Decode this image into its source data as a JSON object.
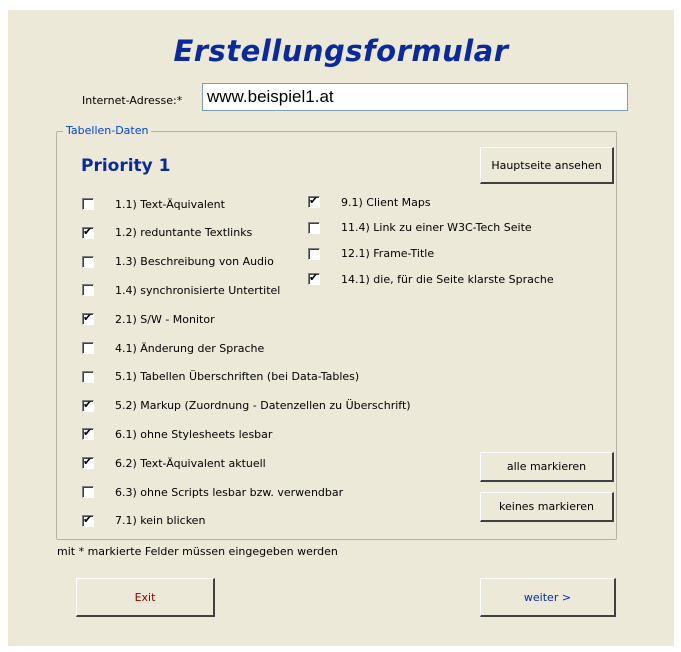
{
  "title": "Erstellungsformular",
  "url_field": {
    "label": "Internet-Adresse:*",
    "value": "www.beispiel1.at"
  },
  "group": {
    "legend": "Tabellen-Daten",
    "heading": "Priority 1"
  },
  "buttons": {
    "main_page": "Hauptseite ansehen",
    "select_all": "alle markieren",
    "select_none": "keines markieren",
    "exit": "Exit",
    "next": "weiter >"
  },
  "left_checks": [
    {
      "label": "1.1) Text-Äquivalent",
      "checked": false
    },
    {
      "label": "1.2) reduntante Textlinks",
      "checked": true
    },
    {
      "label": "1.3) Beschreibung von Audio",
      "checked": false
    },
    {
      "label": "1.4) synchronisierte Untertitel",
      "checked": false
    },
    {
      "label": "2.1) S/W - Monitor",
      "checked": true
    },
    {
      "label": "4.1) Änderung der Sprache",
      "checked": false
    },
    {
      "label": "5.1) Tabellen Überschriften (bei Data-Tables)",
      "checked": false
    },
    {
      "label": "5.2) Markup (Zuordnung - Datenzellen zu Überschrift)",
      "checked": true
    },
    {
      "label": "6.1) ohne Stylesheets lesbar",
      "checked": true
    },
    {
      "label": "6.2) Text-Äquivalent aktuell",
      "checked": true
    },
    {
      "label": "6.3) ohne Scripts lesbar bzw. verwendbar",
      "checked": false
    },
    {
      "label": "7.1) kein blicken",
      "checked": true
    }
  ],
  "right_checks": [
    {
      "label": "9.1) Client Maps",
      "checked": true
    },
    {
      "label": "11.4) Link zu einer W3C-Tech Seite",
      "checked": false
    },
    {
      "label": "12.1) Frame-Title",
      "checked": false
    },
    {
      "label": "14.1) die, für die Seite klarste Sprache",
      "checked": true
    }
  ],
  "note": "mit * markierte Felder müssen eingegeben werden"
}
